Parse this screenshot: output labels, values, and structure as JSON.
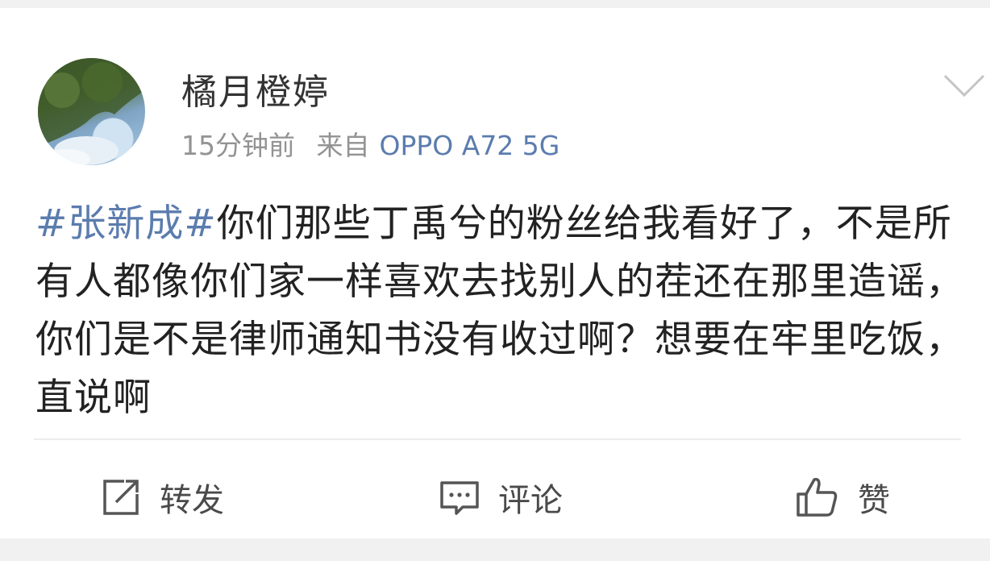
{
  "post": {
    "username": "橘月橙婷",
    "time": "15分钟前",
    "source_prefix": "来自",
    "device": "OPPO A72 5G",
    "topic": "#张新成#",
    "body": "你们那些丁禹兮的粉丝给我看好了，不是所有人都像你们家一样喜欢去找别人的茬还在那里造谣，你们是不是律师通知书没有收过啊？想要在牢里吃饭，直说啊"
  },
  "actions": {
    "repost_label": "转发",
    "comment_label": "评论",
    "like_label": "赞"
  },
  "icons": {
    "avatar": "avatar-image",
    "menu": "chevron-down-icon",
    "repost": "share-icon",
    "comment": "comment-icon",
    "like": "thumbs-up-icon"
  },
  "colors": {
    "link": "#5b7cae",
    "text": "#222222",
    "meta": "#939393"
  }
}
